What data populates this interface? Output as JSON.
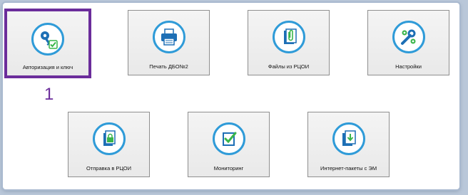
{
  "colors": {
    "tile_background": "#ededed",
    "icon_blue": "#2f9bd8",
    "icon_dark_blue": "#1d6fb5",
    "highlight_purple": "#6b2d9b",
    "check_green": "#39b54a"
  },
  "callout": {
    "number": "1"
  },
  "tiles": [
    {
      "label": "Авторизация и ключ",
      "icon": "key-check-icon",
      "selected": true
    },
    {
      "label": "Печать ДБО№2",
      "icon": "printer-icon",
      "selected": false
    },
    {
      "label": "Файлы из РЦОИ",
      "icon": "paperclip-document-icon",
      "selected": false
    },
    {
      "label": "Настройки",
      "icon": "wrench-gears-icon",
      "selected": false
    },
    {
      "label": "Отправка в РЦОИ",
      "icon": "documents-upload-icon",
      "selected": false
    },
    {
      "label": "Мониторинг",
      "icon": "checklist-icon",
      "selected": false
    },
    {
      "label": "Интернет-пакеты с ЭМ",
      "icon": "package-download-icon",
      "selected": false
    }
  ]
}
